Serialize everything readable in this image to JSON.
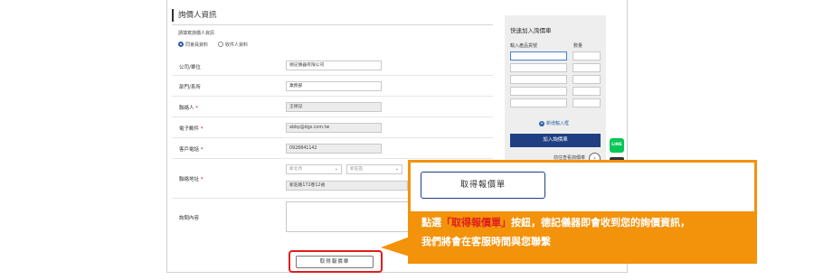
{
  "form": {
    "section_title": "詢價人資訊",
    "subtitle": "請填寫詢價人資訊",
    "radio_options": [
      "同會員資料",
      "收件人資料"
    ],
    "fields": {
      "company": {
        "label": "公司/單位",
        "value": "德記儀器有限公司"
      },
      "department": {
        "label": "部門/系所",
        "value": "業務部"
      },
      "contact": {
        "label": "聯絡人",
        "required_mark": "*",
        "value": "王德記"
      },
      "email": {
        "label": "電子郵件",
        "required_mark": "*",
        "value": "abby@dgs.com.tw"
      },
      "phone": {
        "label": "客戶電話",
        "required_mark": "*",
        "value": "0928841142"
      },
      "address": {
        "label": "聯絡地址",
        "required_mark": "*",
        "city": "新北市",
        "district": "新莊區",
        "street": "新莊路172巷12號"
      },
      "notes": {
        "label": "詢問內容"
      }
    },
    "submit_label": "取得報價單"
  },
  "quick_cart": {
    "title": "快速加入詢價車",
    "col_model": "輸入產品貨號",
    "col_qty": "數量",
    "add_row_link": "新增輸入框",
    "add_button": "加入詢價車",
    "check_link": "前往查看詢價車",
    "circle_icon": "up-arrow-icon"
  },
  "badges": {
    "line": "LINE"
  },
  "callout": {
    "button_label": "取得報價單",
    "line1_prefix": "點選",
    "line1_highlight": "「取得報價單」",
    "line1_suffix": "按鈕，德記儀器即會收到您的詢價資訊，",
    "line2": "我們將會在客服時間與您聯繫"
  },
  "colors": {
    "accent": "#f3920b",
    "primary": "#1f3f82",
    "highlight": "#e11d1d",
    "line_green": "#06c755"
  }
}
